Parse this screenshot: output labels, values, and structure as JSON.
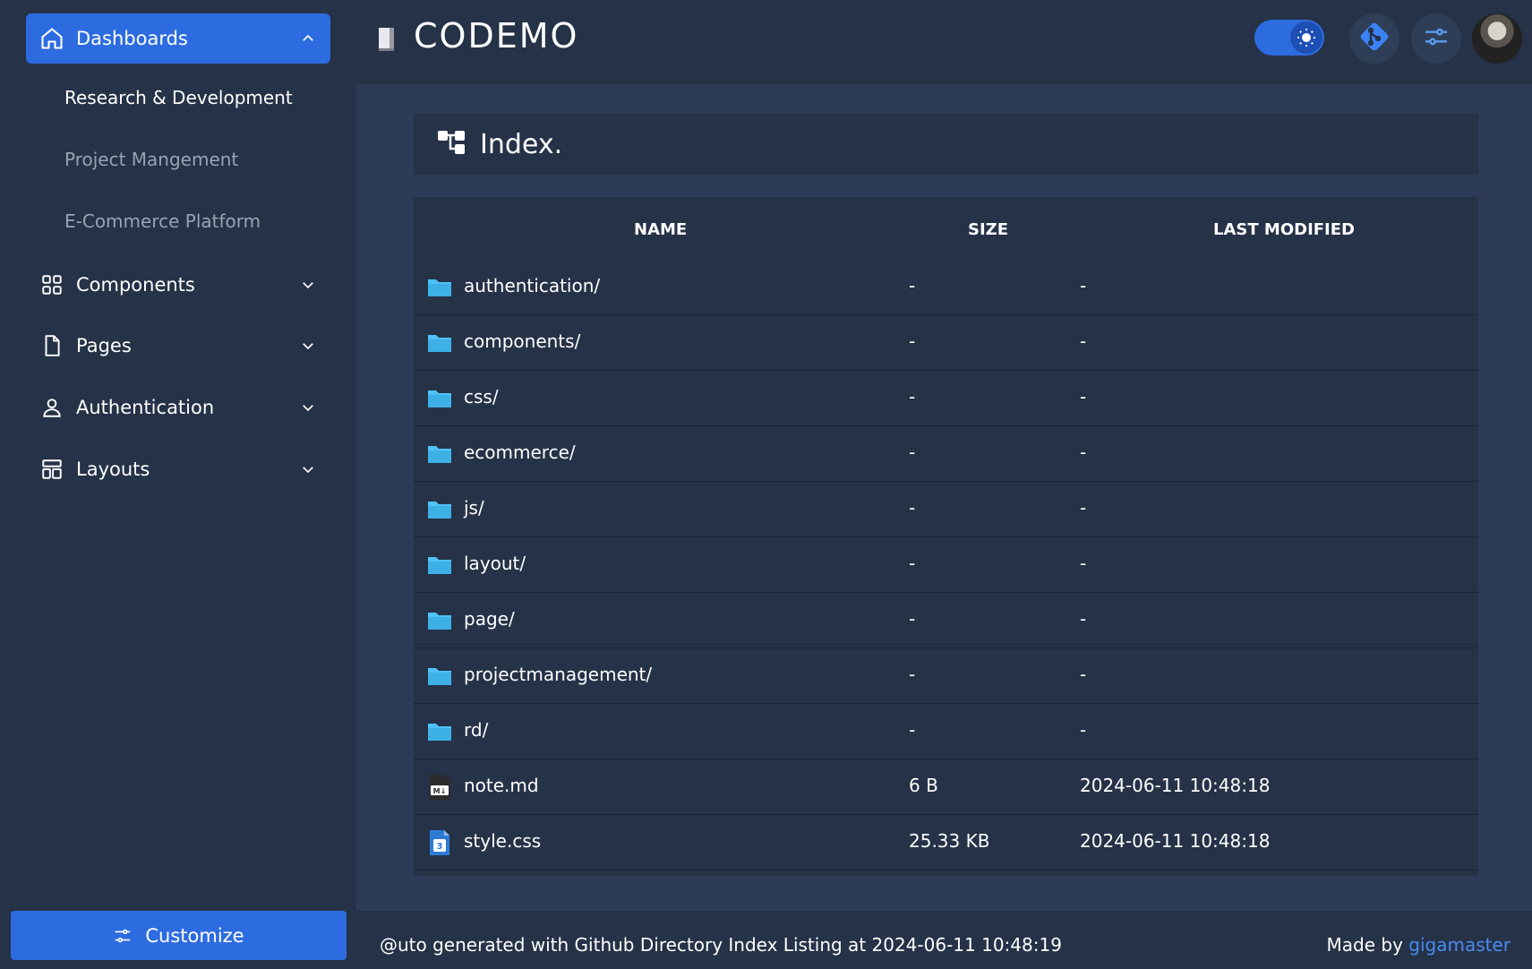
{
  "sidebar": {
    "dashboards_label": "Dashboards",
    "sub_items": [
      "Research & Development",
      "Project Mangement",
      "E-Commerce Platform"
    ],
    "items": [
      {
        "label": "Components",
        "icon": "grid-icon"
      },
      {
        "label": "Pages",
        "icon": "page-icon"
      },
      {
        "label": "Authentication",
        "icon": "user-icon"
      },
      {
        "label": "Layouts",
        "icon": "layout-icon"
      }
    ],
    "customize_label": "Customize"
  },
  "header": {
    "brand": "CODEMO"
  },
  "index": {
    "title": "Index."
  },
  "table": {
    "headers": {
      "name": "NAME",
      "size": "SIZE",
      "modified": "LAST MODIFIED"
    },
    "rows": [
      {
        "name": "authentication/",
        "size": "-",
        "modified": "-",
        "type": "folder"
      },
      {
        "name": "components/",
        "size": "-",
        "modified": "-",
        "type": "folder"
      },
      {
        "name": "css/",
        "size": "-",
        "modified": "-",
        "type": "folder"
      },
      {
        "name": "ecommerce/",
        "size": "-",
        "modified": "-",
        "type": "folder"
      },
      {
        "name": "js/",
        "size": "-",
        "modified": "-",
        "type": "folder"
      },
      {
        "name": "layout/",
        "size": "-",
        "modified": "-",
        "type": "folder"
      },
      {
        "name": "page/",
        "size": "-",
        "modified": "-",
        "type": "folder"
      },
      {
        "name": "projectmanagement/",
        "size": "-",
        "modified": "-",
        "type": "folder"
      },
      {
        "name": "rd/",
        "size": "-",
        "modified": "-",
        "type": "folder"
      },
      {
        "name": "note.md",
        "size": "6 B",
        "modified": "2024-06-11 10:48:18",
        "type": "markdown"
      },
      {
        "name": "style.css",
        "size": "25.33 KB",
        "modified": "2024-06-11 10:48:18",
        "type": "css"
      }
    ]
  },
  "footer": {
    "left_text": "@uto generated with Github Directory Index Listing at 2024-06-11 10:48:19",
    "made_by": "Made by ",
    "author": "gigamaster"
  },
  "colors": {
    "accent": "#2d6ce0",
    "background": "#253247",
    "main_bg": "#2d3c56",
    "folder": "#4fc3f7",
    "link": "#4a8cf0"
  }
}
